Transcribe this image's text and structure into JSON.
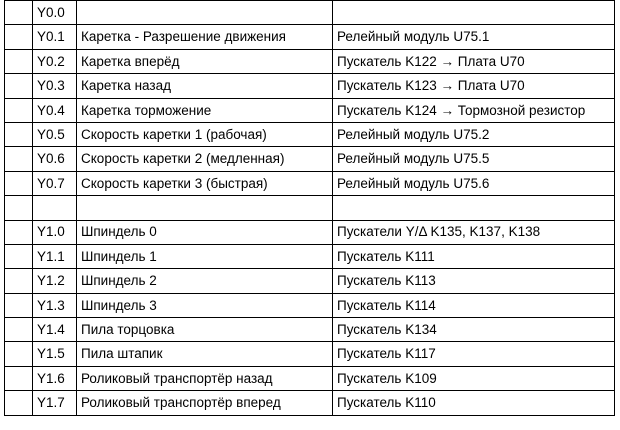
{
  "rows": [
    {
      "addr": "Y0.0",
      "name": "",
      "device": ""
    },
    {
      "addr": "Y0.1",
      "name": "Каретка - Разрешение движения",
      "device": "Релейный модуль U75.1"
    },
    {
      "addr": "Y0.2",
      "name": "Каретка вперёд",
      "device": "Пускатель K122 → Плата U70"
    },
    {
      "addr": "Y0.3",
      "name": "Каретка назад",
      "device": "Пускатель K123 → Плата U70"
    },
    {
      "addr": "Y0.4",
      "name": "Каретка торможение",
      "device": "Пускатель K124 → Тормозной резистор"
    },
    {
      "addr": "Y0.5",
      "name": "Скорость каретки 1 (рабочая)",
      "device": "Релейный модуль U75.2"
    },
    {
      "addr": "Y0.6",
      "name": "Скорость каретки 2 (медленная)",
      "device": "Релейный модуль U75.5"
    },
    {
      "addr": "Y0.7",
      "name": "Скорость каретки 3 (быстрая)",
      "device": "Релейный модуль U75.6"
    },
    {
      "addr": "",
      "name": "",
      "device": ""
    },
    {
      "addr": "Y1.0",
      "name": "Шпиндель 0",
      "device": "Пускатели Y/Δ  K135, K137, K138"
    },
    {
      "addr": "Y1.1",
      "name": "Шпиндель 1",
      "device": "Пускатель K111"
    },
    {
      "addr": "Y1.2",
      "name": "Шпиндель 2",
      "device": "Пускатель K113"
    },
    {
      "addr": "Y1.3",
      "name": "Шпиндель 3",
      "device": "Пускатель K114"
    },
    {
      "addr": "Y1.4",
      "name": "Пила торцовка",
      "device": "Пускатель K134"
    },
    {
      "addr": "Y1.5",
      "name": "Пила штапик",
      "device": "Пускатель K117"
    },
    {
      "addr": "Y1.6",
      "name": "Роликовый транспортёр назад",
      "device": "Пускатель K109"
    },
    {
      "addr": "Y1.7",
      "name": "Роликовый транспортёр вперед",
      "device": "Пускатель K110"
    }
  ]
}
